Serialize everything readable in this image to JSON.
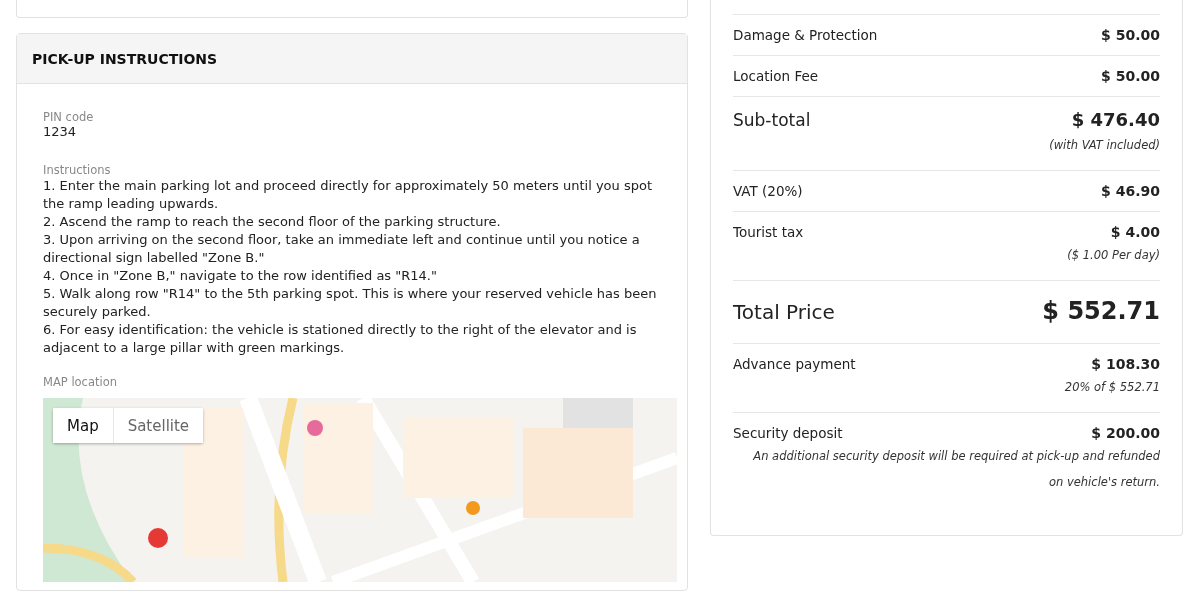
{
  "pickup": {
    "title": "PICK-UP INSTRUCTIONS",
    "pin": {
      "label": "PIN code",
      "value": "1234"
    },
    "instructions": {
      "label": "Instructions",
      "steps": [
        "1. Enter the main parking lot and proceed directly for approximately 50 meters until you spot the ramp leading upwards.",
        "2. Ascend the ramp to reach the second floor of the parking structure.",
        "3. Upon arriving on the second floor, take an immediate left and continue until you notice a directional sign labelled \"Zone B.\"",
        "4. Once in \"Zone B,\" navigate to the row identified as \"R14.\"",
        "5. Walk along row \"R14\" to the 5th parking spot. This is where your reserved vehicle has been securely parked.",
        "6. For easy identification: the vehicle is stationed directly to the right of the elevator and is adjacent to a large pillar with green markings."
      ]
    },
    "map": {
      "label": "MAP location",
      "kind": "picture",
      "toggles": [
        {
          "label": "Map",
          "selected": true
        },
        {
          "label": "Satellite",
          "selected": false
        }
      ]
    }
  },
  "price": {
    "rows": [
      {
        "kind": "normal",
        "label": "Damage & Protection",
        "amount": "$ 50.00"
      },
      {
        "kind": "normal",
        "label": "Location Fee",
        "amount": "$ 50.00"
      },
      {
        "kind": "large",
        "label": "Sub-total",
        "amount": "$ 476.40",
        "note": "(with VAT included)"
      },
      {
        "kind": "normal",
        "label": "VAT (20%)",
        "amount": "$ 46.90"
      },
      {
        "kind": "normal",
        "label": "Tourist tax",
        "amount": "$ 4.00",
        "note": "($ 1.00 Per day)"
      },
      {
        "kind": "total",
        "label": "Total Price",
        "amount": "$ 552.71"
      },
      {
        "kind": "normal",
        "label": "Advance payment",
        "amount": "$ 108.30",
        "note": "20% of $ 552.71"
      },
      {
        "kind": "normal",
        "label": "Security deposit",
        "amount": "$ 200.00",
        "note": "An additional security deposit will be required at pick-up and refunded on vehicle's return."
      }
    ]
  }
}
